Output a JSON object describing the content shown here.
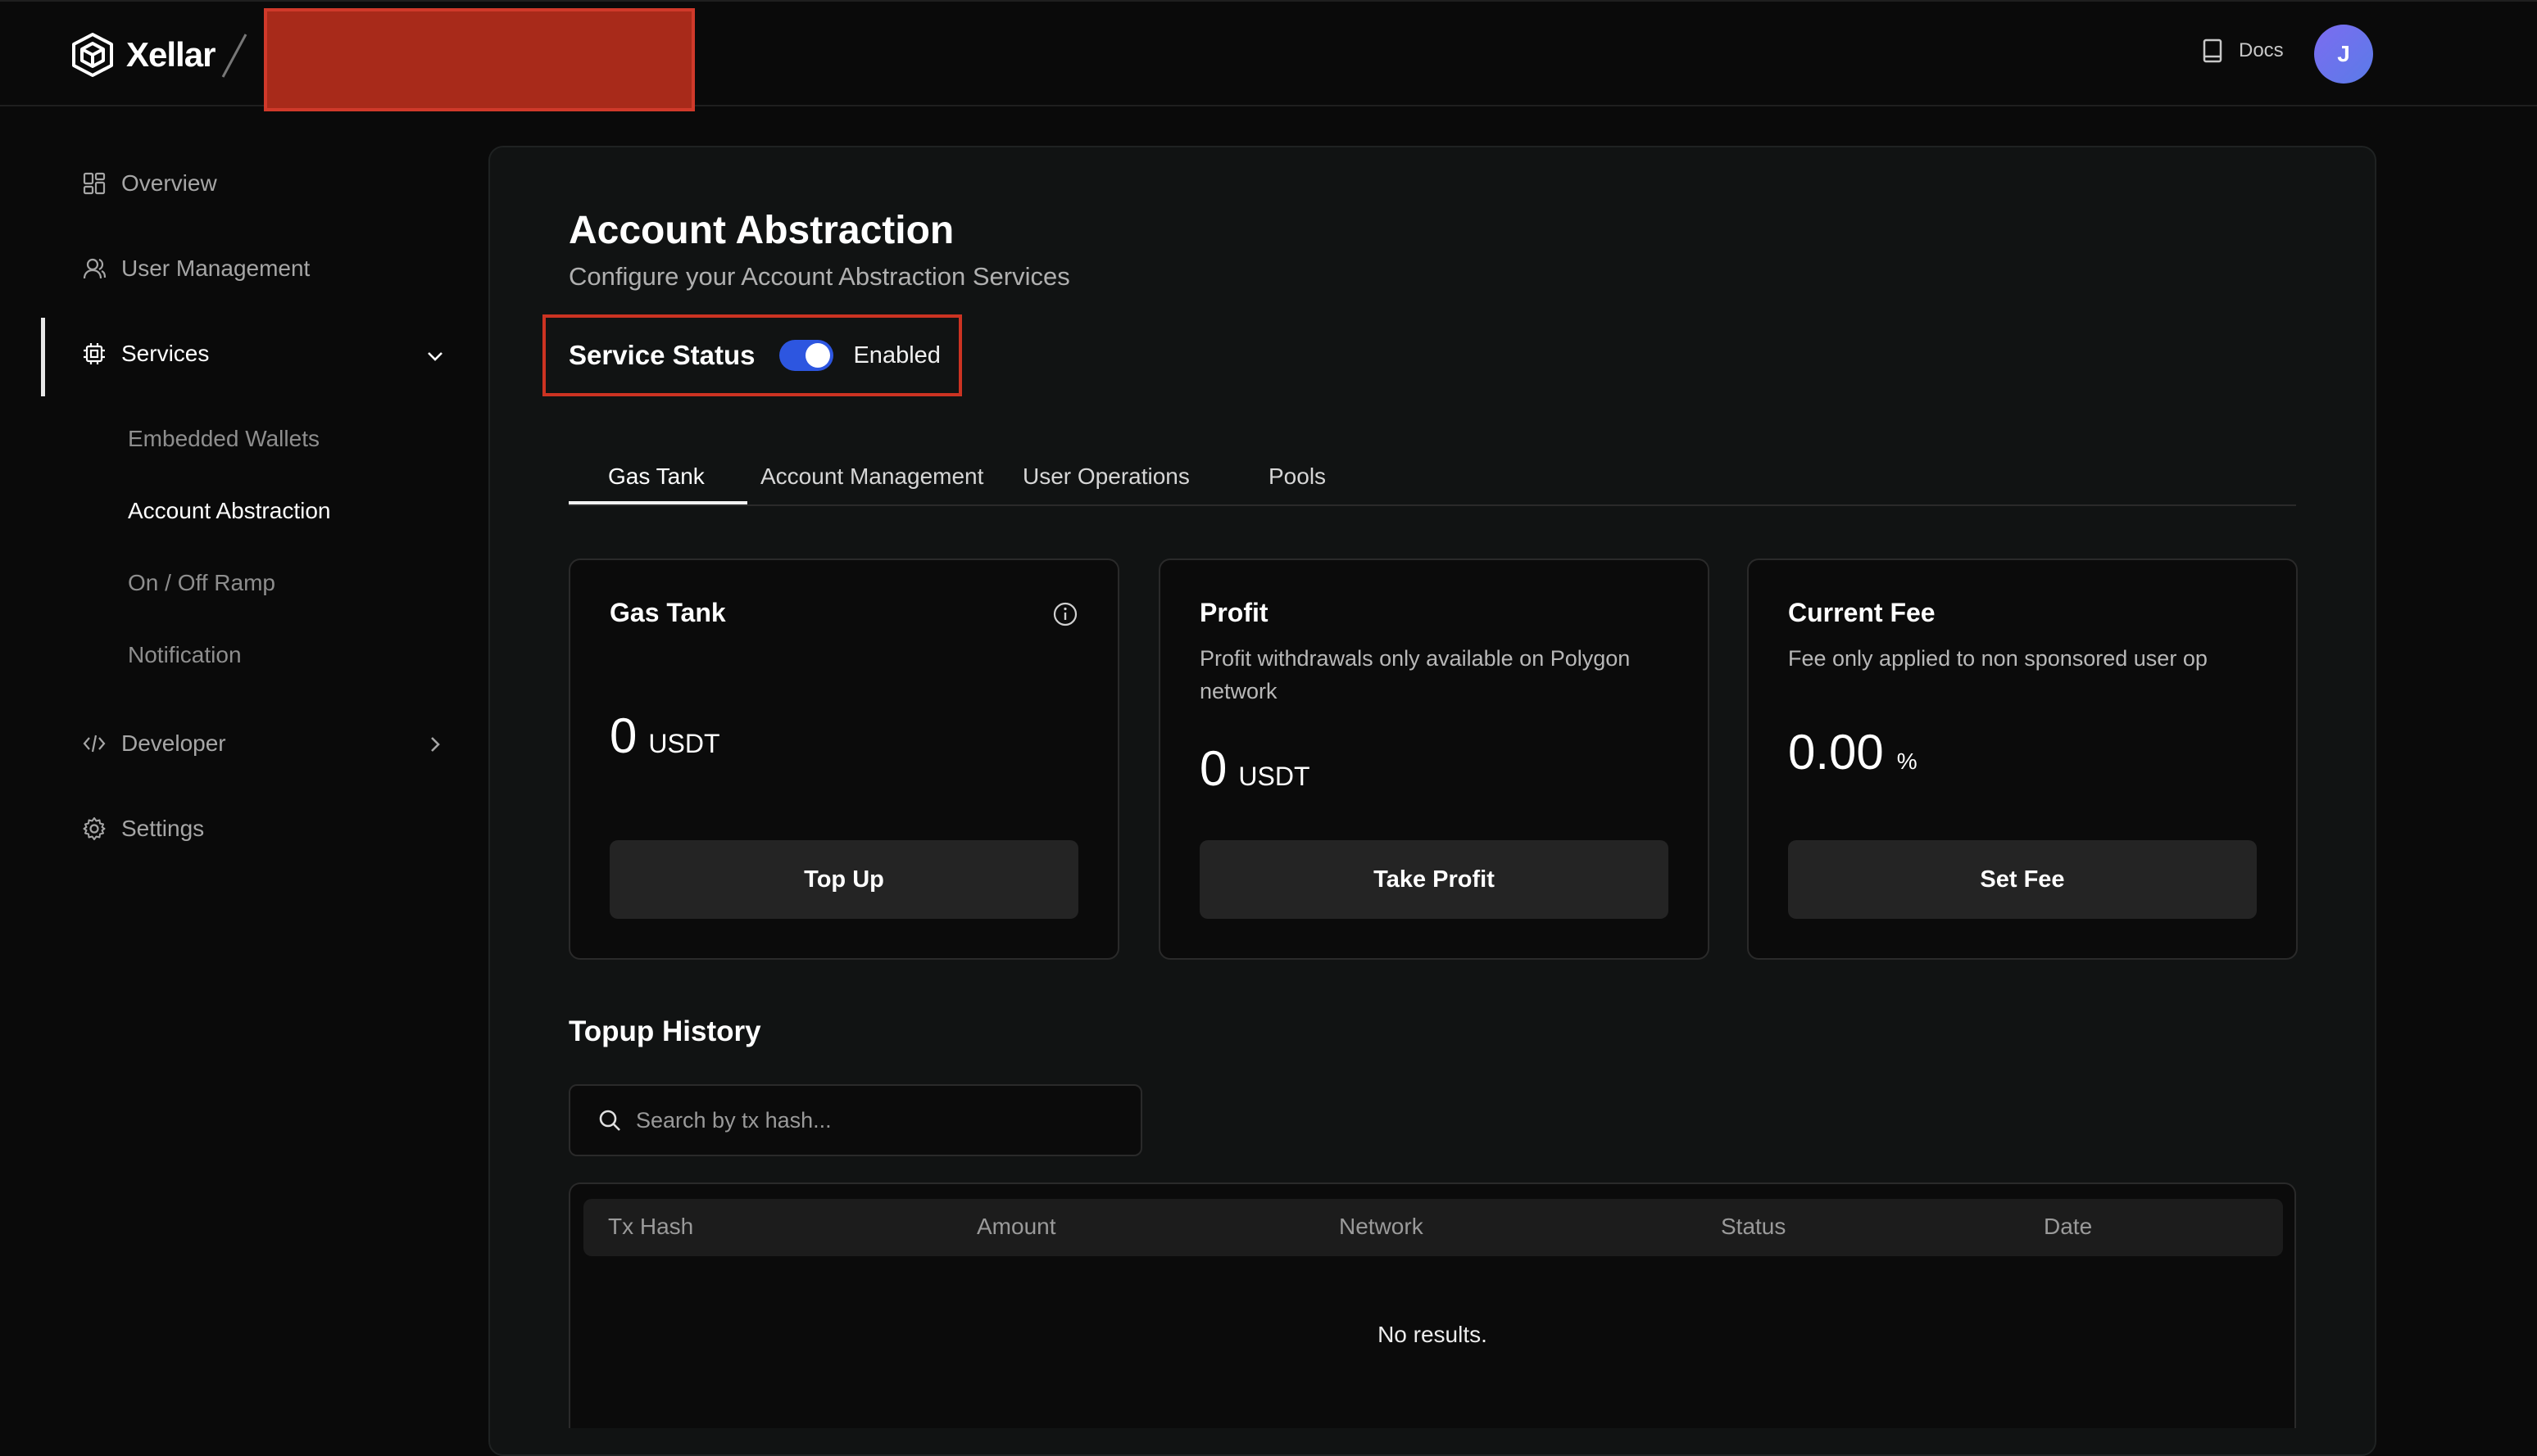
{
  "header": {
    "brand": "Xellar",
    "docs_label": "Docs",
    "avatar_initial": "J"
  },
  "sidebar": {
    "items": [
      {
        "label": "Overview",
        "icon": "grid-icon"
      },
      {
        "label": "User Management",
        "icon": "user-icon"
      },
      {
        "label": "Services",
        "icon": "chip-icon",
        "expanded": true
      },
      {
        "label": "Developer",
        "icon": "code-icon"
      },
      {
        "label": "Settings",
        "icon": "gear-icon"
      }
    ],
    "services_sub": [
      {
        "label": "Embedded Wallets"
      },
      {
        "label": "Account Abstraction",
        "active": true
      },
      {
        "label": "On / Off Ramp"
      },
      {
        "label": "Notification"
      }
    ]
  },
  "main": {
    "title": "Account Abstraction",
    "subtitle": "Configure your Account Abstraction Services",
    "service_status_label": "Service Status",
    "service_status_value": "Enabled",
    "tabs": [
      {
        "label": "Gas Tank",
        "active": true
      },
      {
        "label": "Account Management"
      },
      {
        "label": "User Operations"
      },
      {
        "label": "Pools"
      }
    ],
    "cards": [
      {
        "title": "Gas Tank",
        "description": "",
        "value": "0",
        "unit": "USDT",
        "button": "Top Up"
      },
      {
        "title": "Profit",
        "description": "Profit withdrawals only available on Polygon network",
        "value": "0",
        "unit": "USDT",
        "button": "Take Profit"
      },
      {
        "title": "Current Fee",
        "description": "Fee only applied to non sponsored user op",
        "value": "0.00",
        "unit": "%",
        "button": "Set Fee"
      }
    ],
    "history_title": "Topup History",
    "search_placeholder": "Search by tx hash...",
    "table": {
      "columns": [
        "Tx Hash",
        "Amount",
        "Network",
        "Status",
        "Date"
      ],
      "empty_text": "No results."
    }
  },
  "colors": {
    "background": "#0a0a0a",
    "panel": "#111313",
    "accent_toggle": "#2d56e0",
    "highlight_border": "#cc3322",
    "redaction": "#a82a1a"
  }
}
